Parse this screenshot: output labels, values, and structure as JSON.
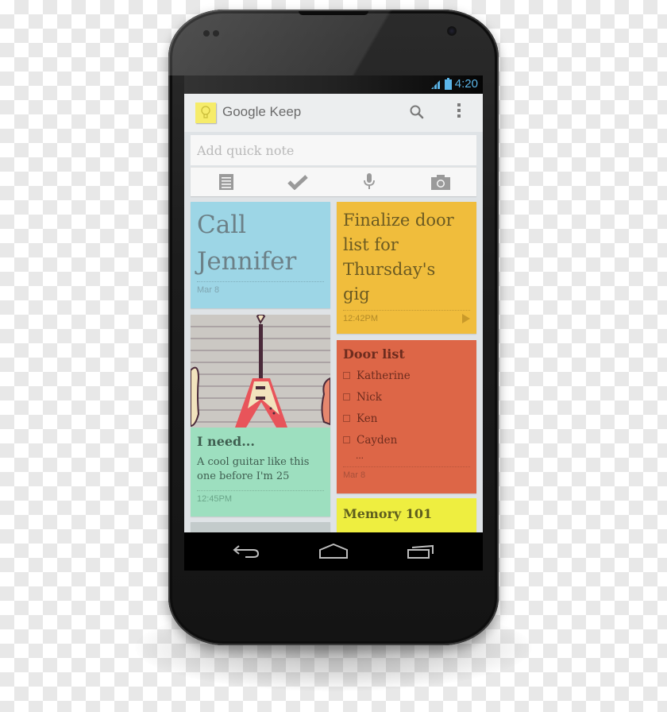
{
  "status_bar": {
    "time": "4:20",
    "signal_icon": "signal-icon",
    "battery_icon": "battery-icon"
  },
  "action_bar": {
    "app_icon": "lightbulb-note-icon",
    "title": "Google Keep",
    "search_icon": "search-icon",
    "overflow_icon": "overflow-menu-icon"
  },
  "quick_note": {
    "placeholder": "Add quick note",
    "value": "",
    "tools": [
      {
        "name": "text-note-icon"
      },
      {
        "name": "checklist-icon"
      },
      {
        "name": "microphone-icon"
      },
      {
        "name": "camera-icon"
      }
    ]
  },
  "notes": {
    "call_jennifer": {
      "title": "Call Jennifer",
      "title_line1": "Call",
      "title_line2": "Jennifer",
      "time": "Mar 8",
      "color": "#9dd6e6"
    },
    "guitar": {
      "image": "flying-v-guitar-illustration",
      "title": "I need...",
      "body": "A cool guitar like this one before I'm 25",
      "time": "12:45PM",
      "color": "#9ddfbf"
    },
    "grey_partial": {
      "color": "#c3cbcb"
    },
    "finalize": {
      "title_lines": [
        "Finalize door",
        "list for",
        "Thursday's",
        "gig"
      ],
      "time": "12:42PM",
      "color": "#f0bd3c",
      "play_icon": "play-icon"
    },
    "door_list": {
      "title": "Door list",
      "items": [
        "Katherine",
        "Nick",
        "Ken",
        "Cayden"
      ],
      "more": "...",
      "time": "Mar 8",
      "color": "#dd6647"
    },
    "memory": {
      "title": "Memory 101",
      "color": "#eeee40"
    }
  },
  "nav_bar": {
    "back": "back-icon",
    "home": "home-icon",
    "recents": "recent-apps-icon"
  }
}
